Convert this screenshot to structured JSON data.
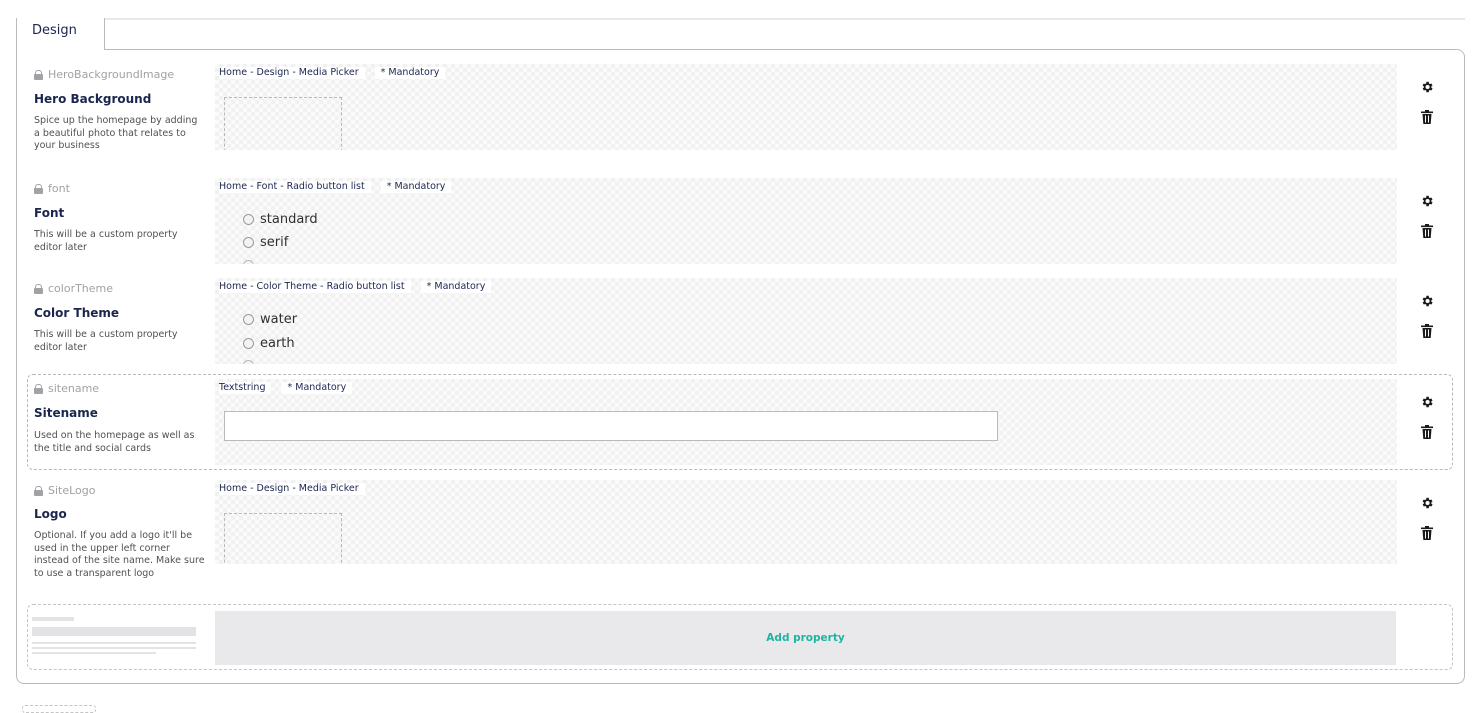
{
  "tab": {
    "label": "Design"
  },
  "properties": [
    {
      "alias": "HeroBackgroundImage",
      "name": "Hero Background",
      "description": "Spice up the homepage by adding a beautiful photo that relates to your business",
      "editor": "Home - Design - Media Picker",
      "mandatory": "* Mandatory"
    },
    {
      "alias": "font",
      "name": "Font",
      "description": "This will be a custom property editor later",
      "editor": "Home - Font - Radio button list",
      "mandatory": "* Mandatory",
      "options": [
        "standard",
        "serif"
      ]
    },
    {
      "alias": "colorTheme",
      "name": "Color Theme",
      "description": "This will be a custom property editor later",
      "editor": "Home - Color Theme - Radio button list",
      "mandatory": "* Mandatory",
      "options": [
        "water",
        "earth"
      ]
    },
    {
      "alias": "sitename",
      "name": "Sitename",
      "description": "Used on the homepage as well as the title and social cards",
      "editor": "Textstring",
      "mandatory": "* Mandatory",
      "value": ""
    },
    {
      "alias": "SiteLogo",
      "name": "Logo",
      "description": "Optional. If you add a logo it'll be used in the upper left corner instead of the site name. Make sure to use a transparent logo",
      "editor": "Home - Design - Media Picker"
    }
  ],
  "add_property": {
    "label": "Add property"
  },
  "icons": {
    "settings": "gear-icon",
    "delete": "trash-icon",
    "locked": "lock-icon"
  },
  "colors": {
    "accent": "#1fb3a3",
    "text": "#1b264f",
    "muted": "#a2a1a6"
  }
}
